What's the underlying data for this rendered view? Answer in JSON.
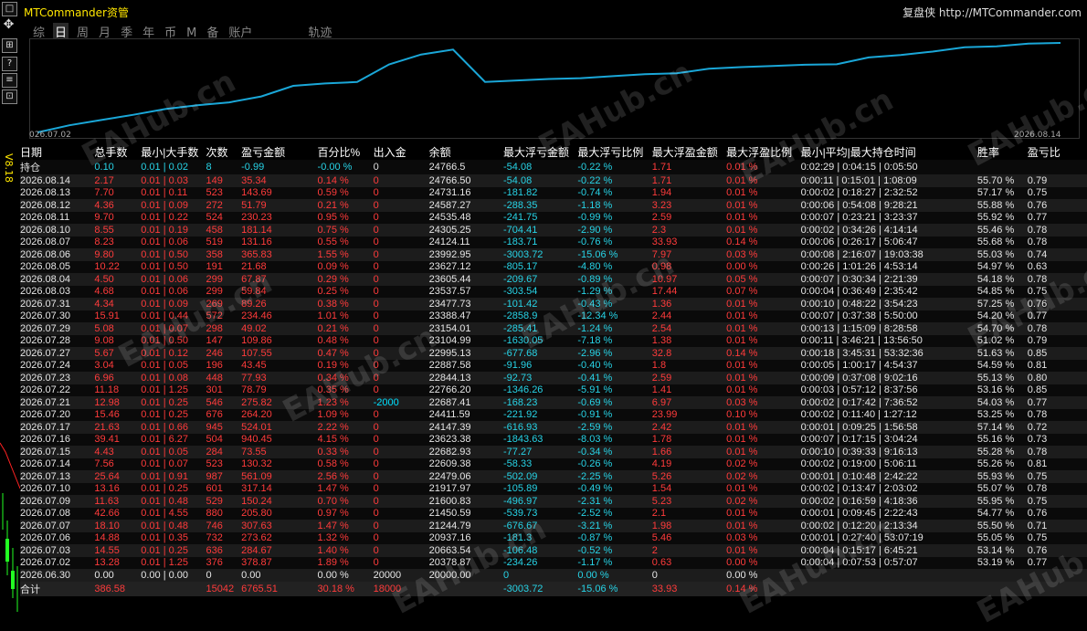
{
  "app": {
    "title": "MTCommander资管",
    "brand": "复盘侠 http://MTCommander.com",
    "version": "V8.18"
  },
  "toolbar": {
    "buttons": [
      "□",
      "✥",
      "⊞",
      "?",
      "≡",
      "⊡"
    ]
  },
  "tabs": [
    "综",
    "日",
    "周",
    "月",
    "季",
    "年",
    "币",
    "M",
    "备",
    "账户",
    "轨迹"
  ],
  "active_tab": "日",
  "equity_chart": {
    "start_label": "026.07.02",
    "end_label": "2026.08.14",
    "line_color": "#1aa7d8",
    "values": [
      20000,
      20378.87,
      20663.54,
      20937.16,
      21244.79,
      21450.59,
      21600.83,
      21917.97,
      22479.06,
      22609.38,
      22682.93,
      23623.38,
      24147.39,
      24411.59,
      22687.41,
      22766.2,
      22844.13,
      22887.58,
      22995.13,
      23104.99,
      23154.01,
      23388.47,
      23477.73,
      23537.57,
      23605.44,
      23627.12,
      23992.95,
      24124.11,
      24305.25,
      24535.48,
      24587.27,
      24731.16,
      24766.5
    ]
  },
  "watermark": "EAHub.cn",
  "table": {
    "headers": [
      "日期",
      "总手数",
      "最小|大手数",
      "次数",
      "盈亏金额",
      "百分比%",
      "出入金",
      "余额",
      "最大浮亏金额",
      "最大浮亏比例",
      "最大浮盈金额",
      "最大浮盈比例",
      "最小|平均|最大持仓时间",
      "胜率",
      "盈亏比"
    ],
    "hold": [
      "持仓",
      "0.10",
      "0.01 | 0.02",
      "8",
      "-0.99",
      "-0.00 %",
      "0",
      "24766.5",
      "-54.08",
      "-0.22 %",
      "1.71",
      "0.01 %",
      "0:02:29 | 0:04:15 | 0:05:50",
      "",
      ""
    ],
    "rows": [
      [
        "2026.08.14",
        "2.17",
        "0.01 | 0.03",
        "149",
        "35.34",
        "0.14 %",
        "0",
        "24766.50",
        "-54.08",
        "-0.22 %",
        "1.71",
        "0.01 %",
        "0:00:11 | 0:15:01 | 1:08:09",
        "55.70 %",
        "0.79"
      ],
      [
        "2026.08.13",
        "7.70",
        "0.01 | 0.11",
        "523",
        "143.69",
        "0.59 %",
        "0",
        "24731.16",
        "-181.82",
        "-0.74 %",
        "1.94",
        "0.01 %",
        "0:00:02 | 0:18:27 | 2:32:52",
        "57.17 %",
        "0.75"
      ],
      [
        "2026.08.12",
        "4.36",
        "0.01 | 0.09",
        "272",
        "51.79",
        "0.21 %",
        "0",
        "24587.27",
        "-288.35",
        "-1.18 %",
        "3.23",
        "0.01 %",
        "0:00:06 | 0:54:08 | 9:28:21",
        "55.88 %",
        "0.76"
      ],
      [
        "2026.08.11",
        "9.70",
        "0.01 | 0.22",
        "524",
        "230.23",
        "0.95 %",
        "0",
        "24535.48",
        "-241.75",
        "-0.99 %",
        "2.59",
        "0.01 %",
        "0:00:07 | 0:23:21 | 3:23:37",
        "55.92 %",
        "0.77"
      ],
      [
        "2026.08.10",
        "8.55",
        "0.01 | 0.19",
        "458",
        "181.14",
        "0.75 %",
        "0",
        "24305.25",
        "-704.41",
        "-2.90 %",
        "2.3",
        "0.01 %",
        "0:00:02 | 0:34:26 | 4:14:14",
        "55.46 %",
        "0.78"
      ],
      [
        "2026.08.07",
        "8.23",
        "0.01 | 0.06",
        "519",
        "131.16",
        "0.55 %",
        "0",
        "24124.11",
        "-183.71",
        "-0.76 %",
        "33.93",
        "0.14 %",
        "0:00:06 | 0:26:17 | 5:06:47",
        "55.68 %",
        "0.78"
      ],
      [
        "2026.08.06",
        "9.80",
        "0.01 | 0.50",
        "358",
        "365.83",
        "1.55 %",
        "0",
        "23992.95",
        "-3003.72",
        "-15.06 %",
        "7.97",
        "0.03 %",
        "0:00:08 | 2:16:07 | 19:03:38",
        "55.03 %",
        "0.74"
      ],
      [
        "2026.08.05",
        "10.22",
        "0.01 | 0.50",
        "191",
        "21.68",
        "0.09 %",
        "0",
        "23627.12",
        "-805.17",
        "-4.80 %",
        "0.98",
        "0.00 %",
        "0:00:26 | 1:01:26 | 4:53:14",
        "54.97 %",
        "0.63"
      ],
      [
        "2026.08.04",
        "4.50",
        "0.01 | 0.06",
        "299",
        "67.87",
        "0.29 %",
        "0",
        "23605.44",
        "-209.67",
        "-0.89 %",
        "10.97",
        "0.05 %",
        "0:00:07 | 0:30:34 | 2:21:39",
        "54.18 %",
        "0.78"
      ],
      [
        "2026.08.03",
        "4.68",
        "0.01 | 0.06",
        "299",
        "59.84",
        "0.25 %",
        "0",
        "23537.57",
        "-303.54",
        "-1.29 %",
        "17.44",
        "0.07 %",
        "0:00:04 | 0:36:49 | 2:35:42",
        "54.85 %",
        "0.75"
      ],
      [
        "2026.07.31",
        "4.34",
        "0.01 | 0.09",
        "269",
        "89.26",
        "0.38 %",
        "0",
        "23477.73",
        "-101.42",
        "-0.43 %",
        "1.36",
        "0.01 %",
        "0:00:10 | 0:48:22 | 3:54:23",
        "57.25 %",
        "0.76"
      ],
      [
        "2026.07.30",
        "15.91",
        "0.01 | 0.44",
        "572",
        "234.46",
        "1.01 %",
        "0",
        "23388.47",
        "-2858.9",
        "-12.34 %",
        "2.44",
        "0.01 %",
        "0:00:07 | 0:37:38 | 5:50:00",
        "54.20 %",
        "0.77"
      ],
      [
        "2026.07.29",
        "5.08",
        "0.01 | 0.07",
        "298",
        "49.02",
        "0.21 %",
        "0",
        "23154.01",
        "-285.41",
        "-1.24 %",
        "2.54",
        "0.01 %",
        "0:00:13 | 1:15:09 | 8:28:58",
        "54.70 %",
        "0.78"
      ],
      [
        "2026.07.28",
        "9.08",
        "0.01 | 0.50",
        "147",
        "109.86",
        "0.48 %",
        "0",
        "23104.99",
        "-1630.05",
        "-7.18 %",
        "1.38",
        "0.01 %",
        "0:00:11 | 3:46:21 | 13:56:50",
        "51.02 %",
        "0.79"
      ],
      [
        "2026.07.27",
        "5.67",
        "0.01 | 0.12",
        "246",
        "107.55",
        "0.47 %",
        "0",
        "22995.13",
        "-677.68",
        "-2.96 %",
        "32.8",
        "0.14 %",
        "0:00:18 | 3:45:31 | 53:32:36",
        "51.63 %",
        "0.85"
      ],
      [
        "2026.07.24",
        "3.04",
        "0.01 | 0.05",
        "196",
        "43.45",
        "0.19 %",
        "0",
        "22887.58",
        "-91.96",
        "-0.40 %",
        "1.8",
        "0.01 %",
        "0:00:05 | 1:00:17 | 4:54:37",
        "54.59 %",
        "0.81"
      ],
      [
        "2026.07.23",
        "6.96",
        "0.01 | 0.08",
        "448",
        "77.93",
        "0.34 %",
        "0",
        "22844.13",
        "-92.73",
        "-0.41 %",
        "2.59",
        "0.01 %",
        "0:00:09 | 0:37:08 | 9:02:16",
        "55.13 %",
        "0.80"
      ],
      [
        "2026.07.22",
        "11.18",
        "0.01 | 1.25",
        "301",
        "78.79",
        "0.35 %",
        "0",
        "22766.20",
        "-1346.26",
        "-5.91 %",
        "1.41",
        "0.01 %",
        "0:00:03 | 0:57:12 | 8:37:56",
        "53.16 %",
        "0.85"
      ],
      [
        "2026.07.21",
        "12.98",
        "0.01 | 0.25",
        "546",
        "275.82",
        "1.23 %",
        "-2000",
        "22687.41",
        "-168.23",
        "-0.69 %",
        "6.97",
        "0.03 %",
        "0:00:02 | 0:17:42 | 7:36:52",
        "54.03 %",
        "0.77"
      ],
      [
        "2026.07.20",
        "15.46",
        "0.01 | 0.25",
        "676",
        "264.20",
        "1.09 %",
        "0",
        "24411.59",
        "-221.92",
        "-0.91 %",
        "23.99",
        "0.10 %",
        "0:00:02 | 0:11:40 | 1:27:12",
        "53.25 %",
        "0.78"
      ],
      [
        "2026.07.17",
        "21.63",
        "0.01 | 0.66",
        "945",
        "524.01",
        "2.22 %",
        "0",
        "24147.39",
        "-616.93",
        "-2.59 %",
        "2.42",
        "0.01 %",
        "0:00:01 | 0:09:25 | 1:56:58",
        "57.14 %",
        "0.72"
      ],
      [
        "2026.07.16",
        "39.41",
        "0.01 | 6.27",
        "504",
        "940.45",
        "4.15 %",
        "0",
        "23623.38",
        "-1843.63",
        "-8.03 %",
        "1.78",
        "0.01 %",
        "0:00:07 | 0:17:15 | 3:04:24",
        "55.16 %",
        "0.73"
      ],
      [
        "2026.07.15",
        "4.43",
        "0.01 | 0.05",
        "284",
        "73.55",
        "0.33 %",
        "0",
        "22682.93",
        "-77.27",
        "-0.34 %",
        "1.66",
        "0.01 %",
        "0:00:10 | 0:39:33 | 9:16:13",
        "55.28 %",
        "0.78"
      ],
      [
        "2026.07.14",
        "7.56",
        "0.01 | 0.07",
        "523",
        "130.32",
        "0.58 %",
        "0",
        "22609.38",
        "-58.33",
        "-0.26 %",
        "4.19",
        "0.02 %",
        "0:00:02 | 0:19:00 | 5:06:11",
        "55.26 %",
        "0.81"
      ],
      [
        "2026.07.13",
        "25.64",
        "0.01 | 0.91",
        "987",
        "561.09",
        "2.56 %",
        "0",
        "22479.06",
        "-502.09",
        "-2.25 %",
        "5.26",
        "0.02 %",
        "0:00:01 | 0:10:48 | 2:42:22",
        "55.93 %",
        "0.75"
      ],
      [
        "2026.07.10",
        "13.16",
        "0.01 | 0.25",
        "601",
        "317.14",
        "1.47 %",
        "0",
        "21917.97",
        "-105.89",
        "-0.49 %",
        "1.54",
        "0.01 %",
        "0:00:02 | 0:13:47 | 2:03:02",
        "55.07 %",
        "0.78"
      ],
      [
        "2026.07.09",
        "11.63",
        "0.01 | 0.48",
        "529",
        "150.24",
        "0.70 %",
        "0",
        "21600.83",
        "-496.97",
        "-2.31 %",
        "5.23",
        "0.02 %",
        "0:00:02 | 0:16:59 | 4:18:36",
        "55.95 %",
        "0.75"
      ],
      [
        "2026.07.08",
        "42.66",
        "0.01 | 4.55",
        "880",
        "205.80",
        "0.97 %",
        "0",
        "21450.59",
        "-539.73",
        "-2.52 %",
        "2.1",
        "0.01 %",
        "0:00:01 | 0:09:45 | 2:22:43",
        "54.77 %",
        "0.76"
      ],
      [
        "2026.07.07",
        "18.10",
        "0.01 | 0.48",
        "746",
        "307.63",
        "1.47 %",
        "0",
        "21244.79",
        "-676.67",
        "-3.21 %",
        "1.98",
        "0.01 %",
        "0:00:02 | 0:12:20 | 2:13:34",
        "55.50 %",
        "0.71"
      ],
      [
        "2026.07.06",
        "14.88",
        "0.01 | 0.35",
        "732",
        "273.62",
        "1.32 %",
        "0",
        "20937.16",
        "-181.3",
        "-0.87 %",
        "5.46",
        "0.03 %",
        "0:00:01 | 0:27:40 | 53:07:19",
        "55.05 %",
        "0.75"
      ],
      [
        "2026.07.03",
        "14.55",
        "0.01 | 0.25",
        "636",
        "284.67",
        "1.40 %",
        "0",
        "20663.54",
        "-106.48",
        "-0.52 %",
        "2",
        "0.01 %",
        "0:00:04 | 0:15:17 | 6:45:21",
        "53.14 %",
        "0.76"
      ],
      [
        "2026.07.02",
        "13.28",
        "0.01 | 1.25",
        "376",
        "378.87",
        "1.89 %",
        "0",
        "20378.87",
        "-234.26",
        "-1.17 %",
        "0.63",
        "0.00 %",
        "0:00:04 | 0:07:53 | 0:57:07",
        "53.19 %",
        "0.77"
      ],
      [
        "2026.06.30",
        "0.00",
        "0.00 | 0.00",
        "0",
        "0.00",
        "0.00 %",
        "20000",
        "20000.00",
        "0",
        "0.00 %",
        "0",
        "0.00 %",
        "",
        "",
        ""
      ]
    ],
    "total": [
      "合计",
      "386.58",
      "",
      "15042",
      "6765.51",
      "30.18 %",
      "18000",
      "",
      "-3003.72",
      "-15.06 %",
      "33.93",
      "0.14 %",
      "",
      "",
      ""
    ]
  }
}
